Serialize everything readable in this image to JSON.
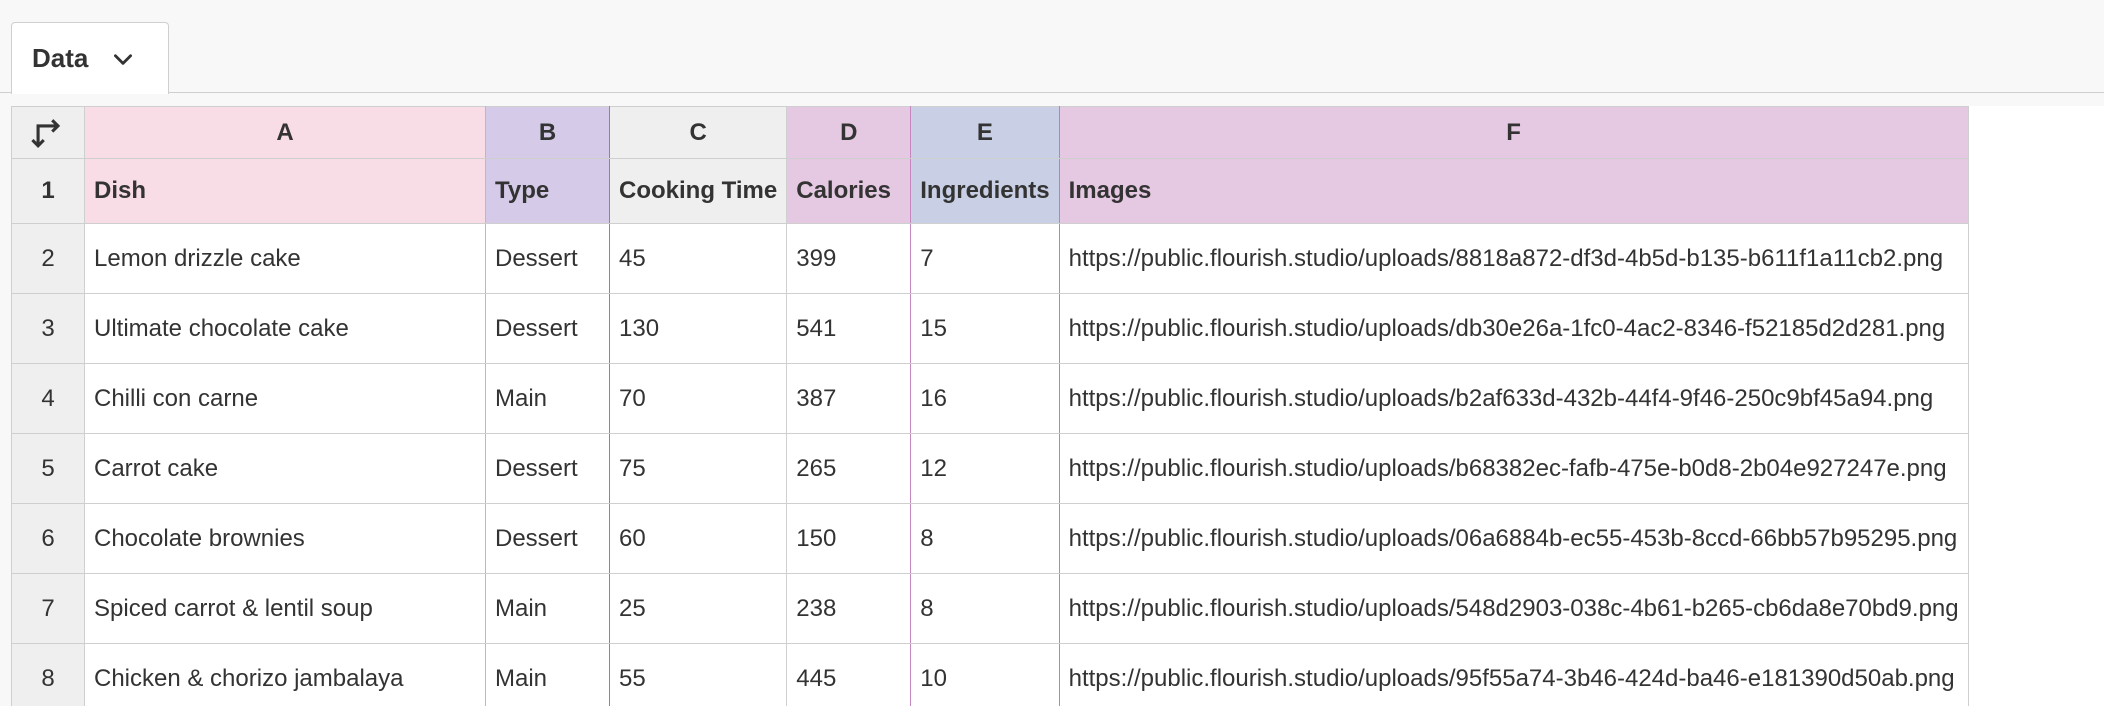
{
  "tab": {
    "label": "Data",
    "icon": "chevron-down-icon"
  },
  "columns": [
    {
      "letter": "A",
      "header": "Dish"
    },
    {
      "letter": "B",
      "header": "Type"
    },
    {
      "letter": "C",
      "header": "Cooking Time"
    },
    {
      "letter": "D",
      "header": "Calories"
    },
    {
      "letter": "E",
      "header": "Ingredients"
    },
    {
      "letter": "F",
      "header": "Images"
    }
  ],
  "row_numbers": [
    "1",
    "2",
    "3",
    "4",
    "5",
    "6",
    "7",
    "8"
  ],
  "rows": [
    [
      "Lemon drizzle cake",
      "Dessert",
      "45",
      "399",
      "7",
      "https://public.flourish.studio/uploads/8818a872-df3d-4b5d-b135-b611f1a11cb2.png"
    ],
    [
      "Ultimate chocolate cake",
      "Dessert",
      "130",
      "541",
      "15",
      "https://public.flourish.studio/uploads/db30e26a-1fc0-4ac2-8346-f52185d2d281.png"
    ],
    [
      "Chilli con carne",
      "Main",
      "70",
      "387",
      "16",
      "https://public.flourish.studio/uploads/b2af633d-432b-44f4-9f46-250c9bf45a94.png"
    ],
    [
      "Carrot cake",
      "Dessert",
      "75",
      "265",
      "12",
      "https://public.flourish.studio/uploads/b68382ec-fafb-475e-b0d8-2b04e927247e.png"
    ],
    [
      "Chocolate brownies",
      "Dessert",
      "60",
      "150",
      "8",
      "https://public.flourish.studio/uploads/06a6884b-ec55-453b-8ccd-66bb57b95295.png"
    ],
    [
      "Spiced carrot & lentil soup",
      "Main",
      "25",
      "238",
      "8",
      "https://public.flourish.studio/uploads/548d2903-038c-4b61-b265-cb6da8e70bd9.png"
    ],
    [
      "Chicken & chorizo jambalaya",
      "Main",
      "55",
      "445",
      "10",
      "https://public.flourish.studio/uploads/95f55a74-3b46-424d-ba46-e181390d50ab.png"
    ]
  ],
  "colors": {
    "col_a": "#f9dde6",
    "col_b": "#d5cbe8",
    "col_d": "#e5c8e1",
    "col_e": "#c9d0e6",
    "col_f": "#e5c8e1",
    "row_header": "#efefef"
  },
  "corner_icon": "transpose-icon"
}
